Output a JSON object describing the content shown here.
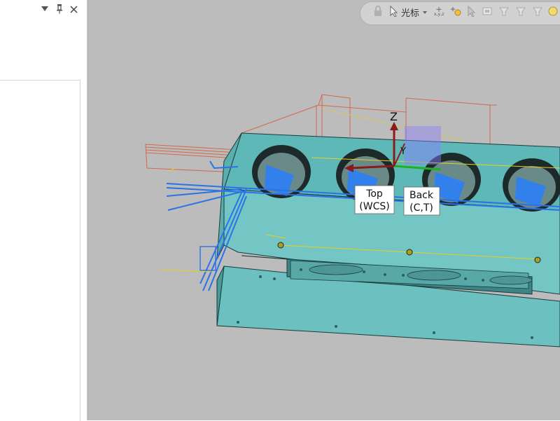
{
  "panel": {
    "menu_icon": "dropdown-triangle",
    "pin_icon": "pin-icon",
    "close_icon": "close-icon"
  },
  "toolbar": {
    "render_mode_label": "光标"
  },
  "viewport": {
    "axis_z": "Z",
    "axis_y": "Y",
    "label_top_line1": "Top",
    "label_top_line2": "(WCS)",
    "label_back_line1": "Back",
    "label_back_line2": "(C,T)"
  }
}
